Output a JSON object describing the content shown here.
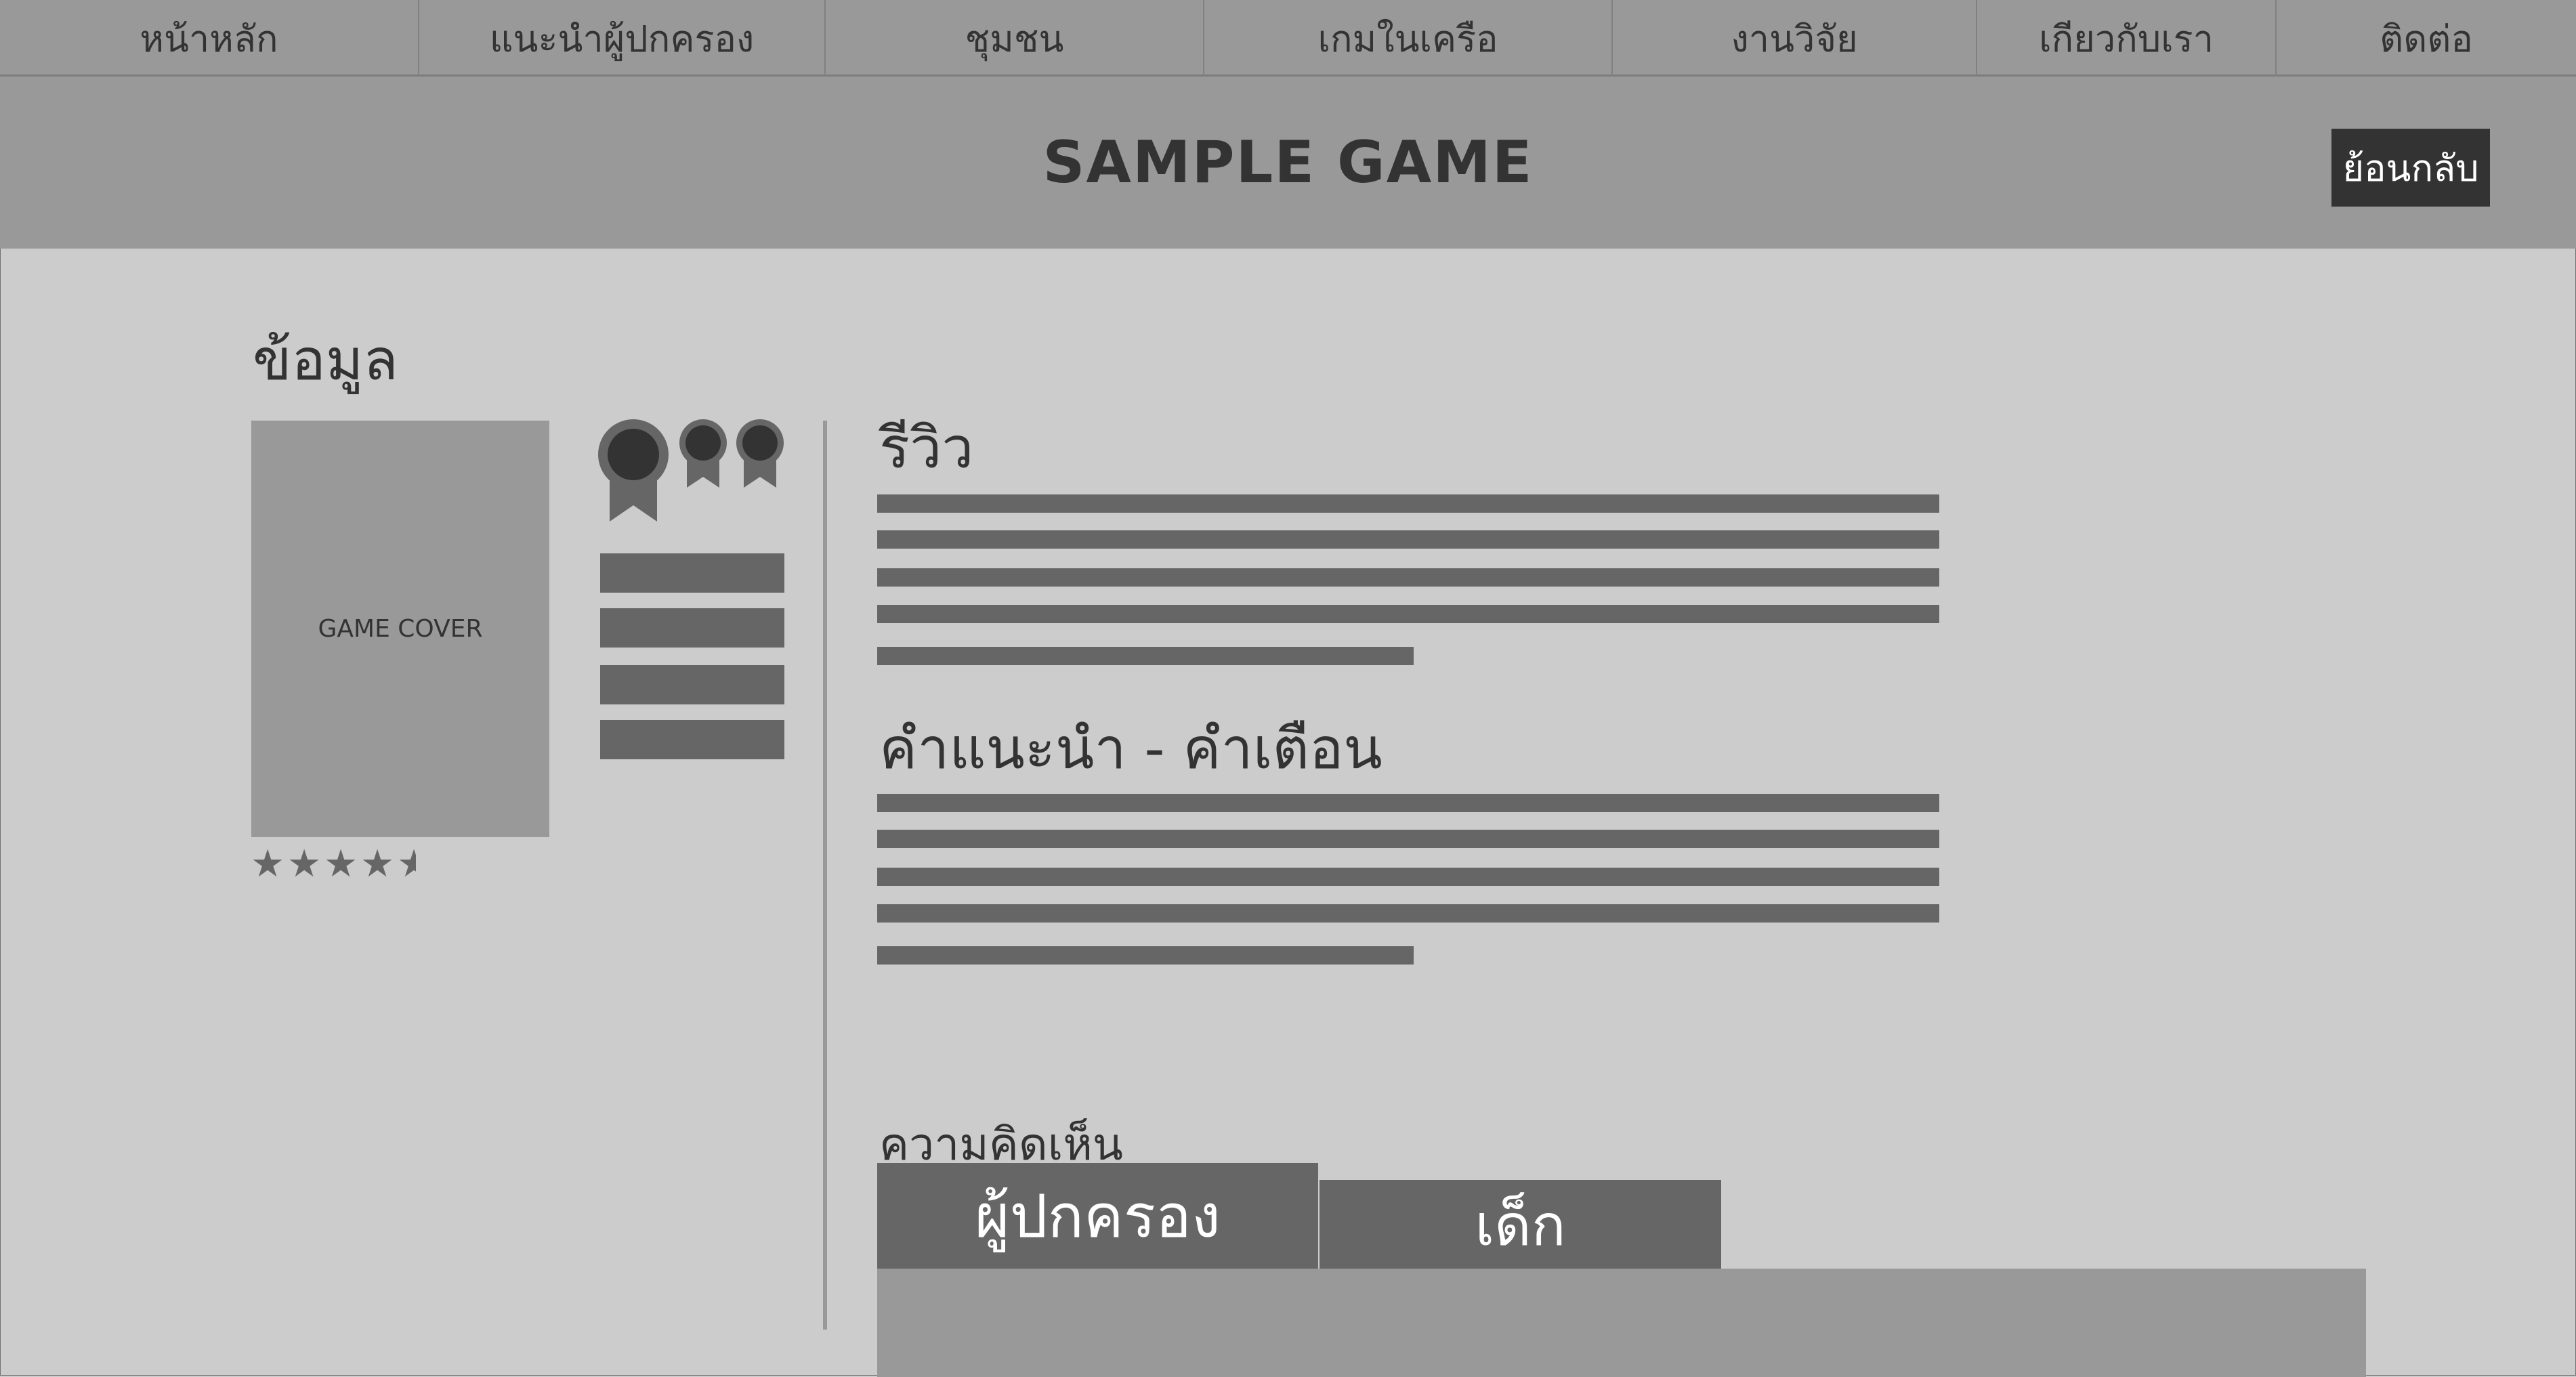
{
  "nav": {
    "items": [
      {
        "label": "หน้าหลัก"
      },
      {
        "label": "แนะนำผู้ปกครอง"
      },
      {
        "label": "ชุมชน"
      },
      {
        "label": "เกมในเครือ"
      },
      {
        "label": "งานวิจัย"
      },
      {
        "label": "เกียวกับเรา"
      },
      {
        "label": "ติดต่อ"
      }
    ]
  },
  "header": {
    "title": "SAMPLE GAME",
    "back_label": "ย้อนกลับ"
  },
  "info": {
    "title": "ข้อมูล",
    "cover_label": "GAME COVER",
    "rating": 4.5,
    "rating_max": 5
  },
  "review": {
    "title": "รีวิว"
  },
  "advice": {
    "title": "คำแนะนำ - คำเตือน"
  },
  "comments": {
    "title": "ความคิดเห็น",
    "tabs": [
      {
        "label": "ผู้ปกครอง",
        "active": true
      },
      {
        "label": "เด็ก",
        "active": false
      }
    ]
  },
  "colors": {
    "background": "#cccccc",
    "panel": "#999999",
    "dark_bar": "#666666",
    "text": "#333333",
    "button": "#333333"
  }
}
